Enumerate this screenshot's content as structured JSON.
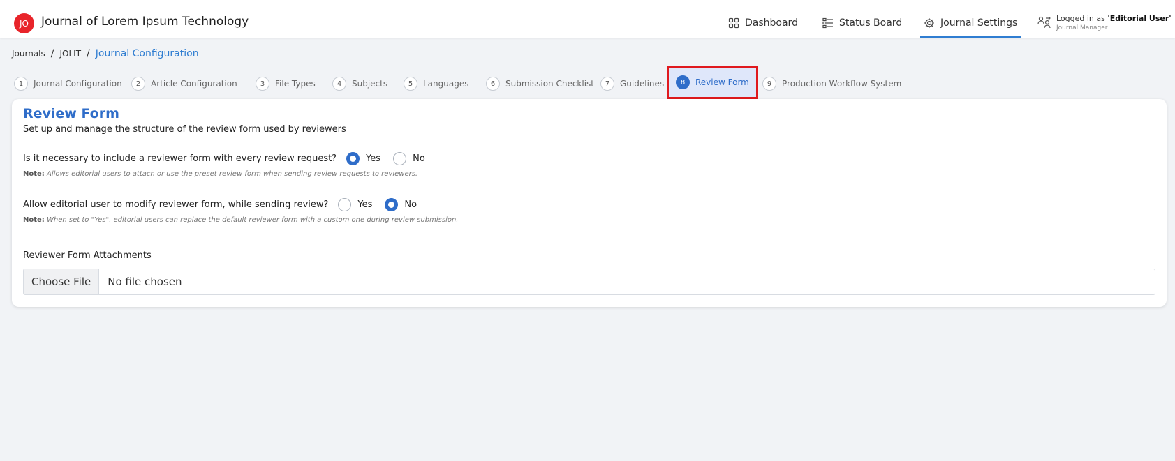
{
  "header": {
    "logo_text": "JO",
    "app_title": "Journal of Lorem Ipsum Technology",
    "nav": {
      "dashboard": "Dashboard",
      "status_board": "Status Board",
      "journal_settings": "Journal Settings"
    },
    "user": {
      "logged_in_prefix": "Logged in as ",
      "user_name": "'Editorial User'",
      "role": "Journal Manager"
    }
  },
  "breadcrumb": {
    "items": [
      "Journals",
      "JOLIT"
    ],
    "current": "Journal Configuration"
  },
  "steps": [
    {
      "num": "1",
      "label": "Journal Configuration"
    },
    {
      "num": "2",
      "label": "Article Configuration"
    },
    {
      "num": "3",
      "label": "File Types"
    },
    {
      "num": "4",
      "label": "Subjects"
    },
    {
      "num": "5",
      "label": "Languages"
    },
    {
      "num": "6",
      "label": "Submission Checklist"
    },
    {
      "num": "7",
      "label": "Guidelines"
    },
    {
      "num": "8",
      "label": "Review Form"
    },
    {
      "num": "9",
      "label": "Production Workflow System"
    }
  ],
  "active_step": 8,
  "form": {
    "title": "Review Form",
    "subtitle": "Set up and manage the structure of the review form used by reviewers",
    "q1": {
      "question": "Is it necessary to include a reviewer form with every review request?",
      "yes": "Yes",
      "no": "No",
      "selected": "yes",
      "note_label": "Note:",
      "note": " Allows editorial users to attach or use the preset review form when sending review requests to reviewers."
    },
    "q2": {
      "question": "Allow editorial user to modify reviewer form, while sending review?",
      "yes": "Yes",
      "no": "No",
      "selected": "no",
      "note_label": "Note:",
      "note": " When set to \"Yes\", editorial users can replace the default reviewer form with a custom one during review submission."
    },
    "attachments_label": "Reviewer Form Attachments",
    "file_button": "Choose File",
    "file_status": "No file chosen"
  },
  "colors": {
    "accent": "#2f6dc9",
    "logo": "#e8242a",
    "highlight_border": "#e0191e"
  }
}
